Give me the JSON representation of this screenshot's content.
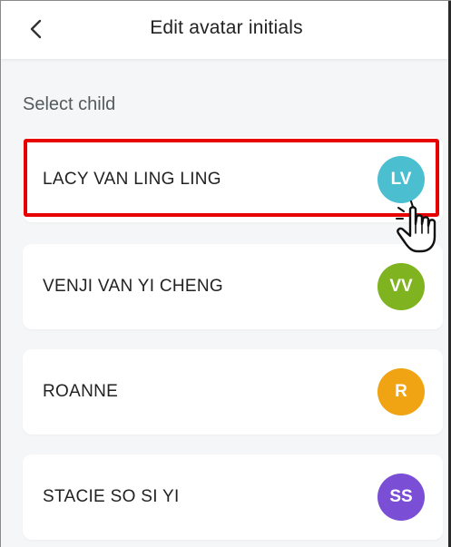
{
  "header": {
    "back_icon": "chevron-left-icon",
    "title": "Edit avatar initials"
  },
  "section": {
    "label": "Select child"
  },
  "children": [
    {
      "name": "LACY VAN LING LING",
      "initials": "LV",
      "color": "#4bbfd0",
      "highlighted": true
    },
    {
      "name": "VENJI VAN YI CHENG",
      "initials": "VV",
      "color": "#7fb31f",
      "highlighted": false
    },
    {
      "name": "ROANNE",
      "initials": "R",
      "color": "#f0a313",
      "highlighted": false
    },
    {
      "name": "STACIE SO SI YI",
      "initials": "SS",
      "color": "#7a4fd6",
      "highlighted": false
    }
  ],
  "overlay": {
    "highlight_color": "#e60000",
    "cursor_icon": "hand-pointer-icon"
  }
}
